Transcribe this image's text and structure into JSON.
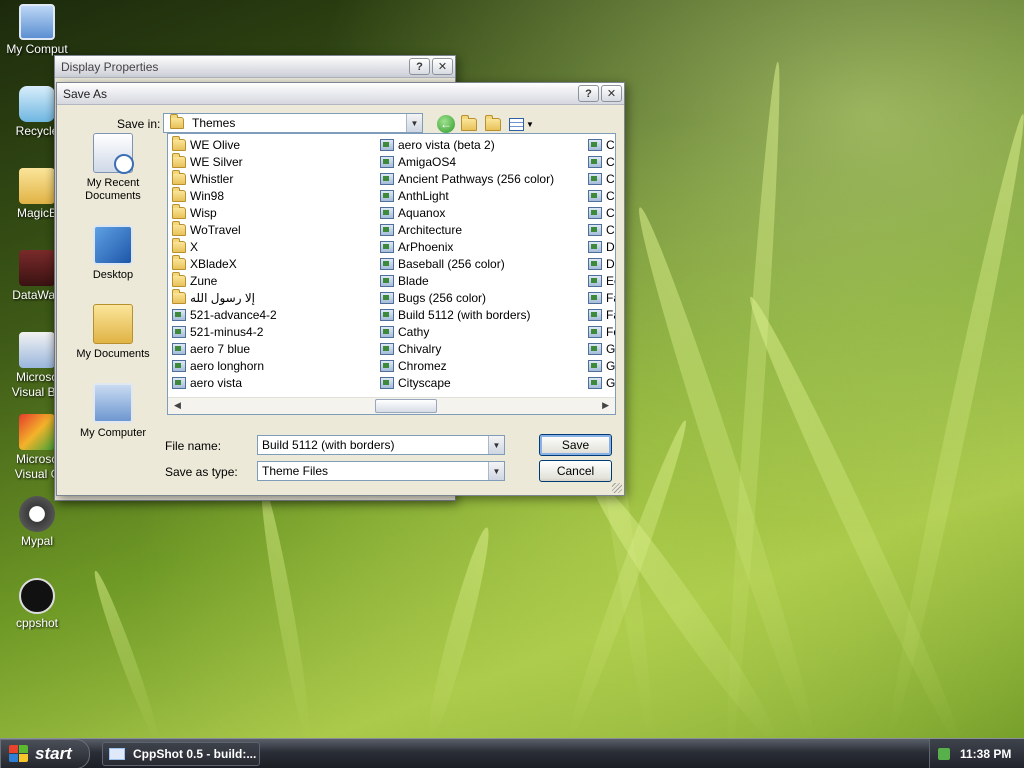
{
  "desktop": {
    "icons": [
      {
        "label": "My Comput",
        "icon": "my-computer-icon"
      },
      {
        "label": "Recycle",
        "icon": "recycle-bin-icon"
      },
      {
        "label": "MagicB",
        "icon": "folder-icon"
      },
      {
        "label": "DataWag",
        "icon": "datawag-shortcut-icon"
      },
      {
        "label": "Microso Visual Ba",
        "icon": "visual-basic-shortcut-icon"
      },
      {
        "label": "Microso Visual C",
        "icon": "visual-c-shortcut-icon"
      },
      {
        "label": "Mypal",
        "icon": "mypal-shortcut-icon"
      },
      {
        "label": "cppshot",
        "icon": "cppshot-shortcut-icon"
      }
    ]
  },
  "display_properties": {
    "title": "Display Properties",
    "help_label": "?",
    "close_label": "✕"
  },
  "save_as": {
    "title": "Save As",
    "help_label": "?",
    "close_label": "✕",
    "save_in_label": "Save in:",
    "save_in_value": "Themes",
    "places": [
      {
        "label": "My Recent Documents",
        "icon": "recent-documents-icon"
      },
      {
        "label": "Desktop",
        "icon": "desktop-icon"
      },
      {
        "label": "My Documents",
        "icon": "my-documents-icon"
      },
      {
        "label": "My Computer",
        "icon": "my-computer-icon"
      }
    ],
    "columns": [
      {
        "items": [
          {
            "name": "WE Olive",
            "type": "folder"
          },
          {
            "name": "WE Silver",
            "type": "folder"
          },
          {
            "name": "Whistler",
            "type": "folder"
          },
          {
            "name": "Win98",
            "type": "folder"
          },
          {
            "name": "Wisp",
            "type": "folder"
          },
          {
            "name": "WoTravel",
            "type": "folder"
          },
          {
            "name": "X",
            "type": "folder"
          },
          {
            "name": "XBladeX",
            "type": "folder"
          },
          {
            "name": "Zune",
            "type": "folder"
          },
          {
            "name": "إلا رسول الله",
            "type": "folder"
          },
          {
            "name": "521-advance4-2",
            "type": "theme"
          },
          {
            "name": "521-minus4-2",
            "type": "theme"
          },
          {
            "name": "aero 7 blue",
            "type": "theme"
          },
          {
            "name": "aero longhorn",
            "type": "theme"
          },
          {
            "name": "aero vista",
            "type": "theme"
          }
        ]
      },
      {
        "items": [
          {
            "name": "aero vista (beta 2)",
            "type": "theme"
          },
          {
            "name": "AmigaOS4",
            "type": "theme"
          },
          {
            "name": "Ancient Pathways (256 color)",
            "type": "theme"
          },
          {
            "name": "AnthLight",
            "type": "theme"
          },
          {
            "name": "Aquanox",
            "type": "theme"
          },
          {
            "name": "Architecture",
            "type": "theme"
          },
          {
            "name": "ArPhoenix",
            "type": "theme"
          },
          {
            "name": "Baseball (256 color)",
            "type": "theme"
          },
          {
            "name": "Blade",
            "type": "theme"
          },
          {
            "name": "Bugs (256 color)",
            "type": "theme"
          },
          {
            "name": "Build 5112 (with borders)",
            "type": "theme"
          },
          {
            "name": "Cathy",
            "type": "theme"
          },
          {
            "name": "Chivalry",
            "type": "theme"
          },
          {
            "name": "Chromez",
            "type": "theme"
          },
          {
            "name": "Cityscape",
            "type": "theme"
          }
        ]
      },
      {
        "items": [
          {
            "name": "Cc",
            "type": "theme"
          },
          {
            "name": "Cc",
            "type": "theme"
          },
          {
            "name": "Cc",
            "type": "theme"
          },
          {
            "name": "Cc",
            "type": "theme"
          },
          {
            "name": "Cc",
            "type": "theme"
          },
          {
            "name": "Cc",
            "type": "theme"
          },
          {
            "name": "Da",
            "type": "theme"
          },
          {
            "name": "Dc",
            "type": "theme"
          },
          {
            "name": "Ec",
            "type": "theme"
          },
          {
            "name": "Fa",
            "type": "theme"
          },
          {
            "name": "Fa",
            "type": "theme"
          },
          {
            "name": "Fo",
            "type": "theme"
          },
          {
            "name": "Ga",
            "type": "theme"
          },
          {
            "name": "Ge",
            "type": "theme"
          },
          {
            "name": "Ge",
            "type": "theme"
          }
        ]
      }
    ],
    "file_name_label": "File name:",
    "file_name_value": "Build 5112 (with borders)",
    "save_as_type_label": "Save as type:",
    "save_as_type_value": "Theme Files",
    "save_button": "Save",
    "cancel_button": "Cancel"
  },
  "taskbar": {
    "start_label": "start",
    "task_label": "CppShot 0.5 - build:...",
    "clock": "11:38 PM"
  }
}
